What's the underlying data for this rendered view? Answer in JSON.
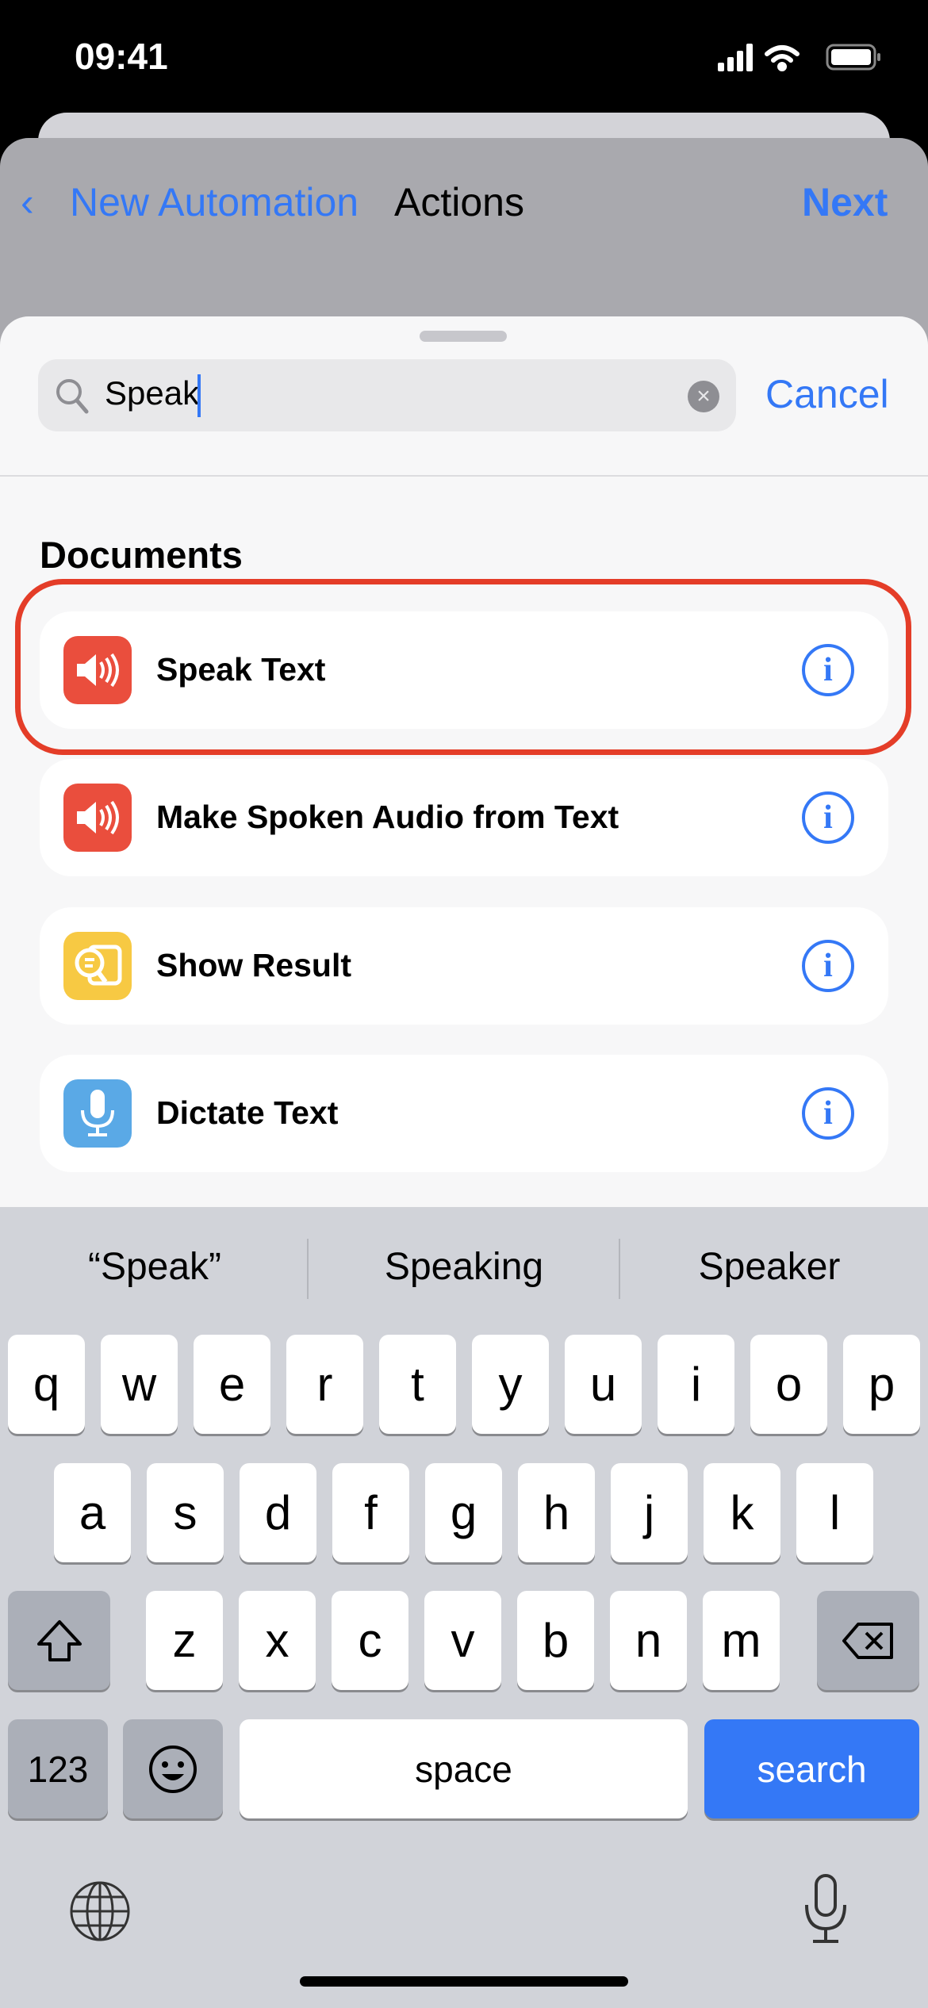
{
  "status_bar": {
    "time": "09:41",
    "icons": [
      "cellular-signal-icon",
      "wifi-icon",
      "battery-icon"
    ]
  },
  "nav": {
    "back_label": "New Automation",
    "title": "Actions",
    "next_label": "Next"
  },
  "search": {
    "value": "Speak",
    "cancel_label": "Cancel",
    "icon": "magnifier-icon",
    "clear_icon": "clear-x-icon"
  },
  "section_title": "Documents",
  "actions": [
    {
      "label": "Speak Text",
      "icon": "speaker-icon",
      "color": "#ea4e3d",
      "highlighted": true
    },
    {
      "label": "Make Spoken Audio from Text",
      "icon": "speaker-icon",
      "color": "#ea4e3d"
    },
    {
      "label": "Show Result",
      "icon": "show-result-icon",
      "color": "#f7c943"
    },
    {
      "label": "Dictate Text",
      "icon": "microphone-icon",
      "color": "#5aa9e6"
    }
  ],
  "info_glyph": "i",
  "keyboard": {
    "suggestions": [
      "“Speak”",
      "Speaking",
      "Speaker"
    ],
    "row1": [
      "q",
      "w",
      "e",
      "r",
      "t",
      "y",
      "u",
      "i",
      "o",
      "p"
    ],
    "row2": [
      "a",
      "s",
      "d",
      "f",
      "g",
      "h",
      "j",
      "k",
      "l"
    ],
    "row3": [
      "z",
      "x",
      "c",
      "v",
      "b",
      "n",
      "m"
    ],
    "numbers_label": "123",
    "space_label": "space",
    "search_label": "search",
    "accent": "#3478f6"
  }
}
